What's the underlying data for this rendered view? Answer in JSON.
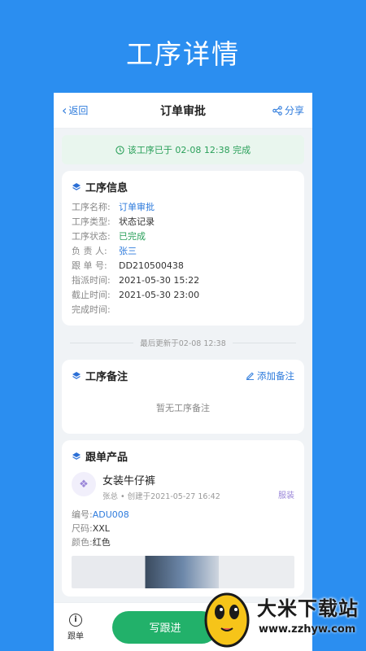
{
  "hero": {
    "title": "工序详情"
  },
  "nav": {
    "back_label": "返回",
    "title": "订单审批",
    "share_label": "分享"
  },
  "banner": {
    "text": "该工序已于 02-08 12:38 完成"
  },
  "process_info": {
    "header": "工序信息",
    "fields": [
      {
        "key": "工序名称:",
        "value": "订单审批",
        "color": "blue"
      },
      {
        "key": "工序类型:",
        "value": "状态记录",
        "color": ""
      },
      {
        "key": "工序状态:",
        "value": "已完成",
        "color": "green"
      },
      {
        "key": "负 责 人:",
        "value": "张三",
        "color": "blue"
      },
      {
        "key": "跟 单 号:",
        "value": "DD210500438",
        "color": ""
      },
      {
        "key": "指派时间:",
        "value": "2021-05-30 15:22",
        "color": ""
      },
      {
        "key": "截止时间:",
        "value": "2021-05-30 23:00",
        "color": ""
      },
      {
        "key": "完成时间:",
        "value": "",
        "color": ""
      }
    ]
  },
  "last_updated": "最后更新于02-08 12:38",
  "notes": {
    "header": "工序备注",
    "add_label": "添加备注",
    "empty": "暂无工序备注"
  },
  "product": {
    "header": "跟单产品",
    "name": "女装牛仔裤",
    "meta": "张总 • 创建于2021-05-27 16:42",
    "tag": "服装",
    "attrs": [
      {
        "key": "编号:",
        "value": "ADU008",
        "color": "blue"
      },
      {
        "key": "尺码:",
        "value": "XXL",
        "color": ""
      },
      {
        "key": "颜色:",
        "value": "红色",
        "color": ""
      }
    ]
  },
  "bottom": {
    "follow_label": "跟单",
    "write_label": "写跟进"
  },
  "watermark": {
    "title": "大米下载站",
    "url": "www.zzhyw.com"
  },
  "colors": {
    "primary": "#2b8ef0",
    "link": "#2e7bdc",
    "success": "#2aa05a",
    "button": "#22b16a"
  }
}
